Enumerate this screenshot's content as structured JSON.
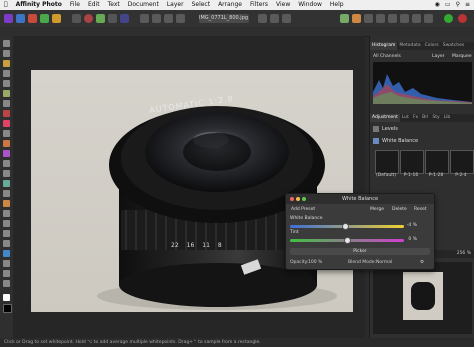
{
  "menubar": {
    "app_name": "Affinity Photo",
    "items": [
      "File",
      "Edit",
      "Text",
      "Document",
      "Layer",
      "Select",
      "Arrange",
      "Filters",
      "View",
      "Window",
      "Help"
    ]
  },
  "document": {
    "title": "IMG_0771L_800.jpg (50..."
  },
  "panels": {
    "top_tabs": [
      "Histogram",
      "Metadata",
      "Colors",
      "Swatches"
    ],
    "channels_select": "All Channels",
    "layer_label": "Layer",
    "marquee_label": "Marquee",
    "mid_tabs": [
      "Adjustment",
      "Lut",
      "Fx",
      "Brl",
      "Sty",
      "Lib"
    ],
    "adjustments": [
      "Levels",
      "White Balance"
    ],
    "presets": [
      "(Default)",
      "P-1-16",
      "P-1-28",
      "P-2-4"
    ],
    "zoom": "256 %"
  },
  "white_balance": {
    "title": "White Balance",
    "add_preset": "Add Preset",
    "merge": "Merge",
    "delete": "Delete",
    "reset": "Reset",
    "wb_label": "White Balance",
    "wb_value": "-4 %",
    "wb_level": -0.04,
    "tint_label": "Tint",
    "tint_value": "0 %",
    "tint_level": 0.0,
    "picker": "Picker",
    "opacity_label": "Opacity:",
    "opacity_value": "100 %",
    "blend_label": "Blend Mode:",
    "blend_value": "Normal"
  },
  "photo": {
    "lens_text": "AUTOMATIC 1:2.8",
    "lens_marks": [
      "22",
      "16",
      "11",
      "8"
    ]
  },
  "status": {
    "text": "Click or Drag to set whitepoint. Hold ⌥ to add average multiple whitepoints. Drag+⌃ to sample from a rectangle."
  }
}
